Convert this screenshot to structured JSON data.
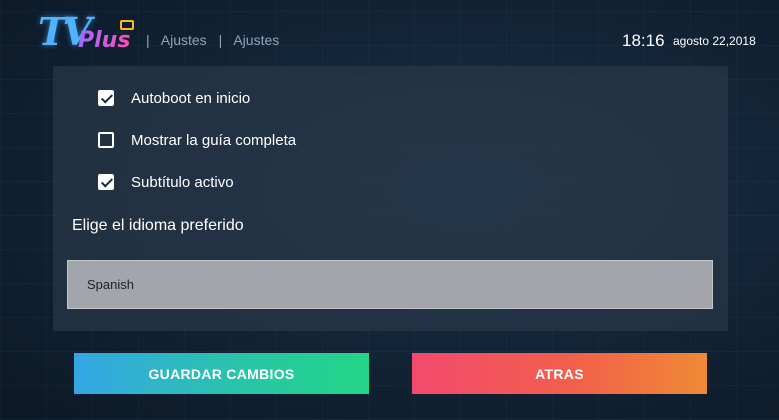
{
  "app": {
    "logo_tv": "TV",
    "logo_plus": "Plus"
  },
  "breadcrumb": {
    "sep1": "|",
    "item1": "Ajustes",
    "sep2": "|",
    "item2": "Ajustes"
  },
  "status": {
    "time": "18:16",
    "date": "agosto 22,2018"
  },
  "options": [
    {
      "label": "Autoboot en inicio",
      "checked": true
    },
    {
      "label": "Mostrar la guía completa",
      "checked": false
    },
    {
      "label": "Subtítulo activo",
      "checked": true
    }
  ],
  "language": {
    "title": "Elige el idioma preferido",
    "selected": "Spanish"
  },
  "buttons": {
    "save": "GUARDAR CAMBIOS",
    "back": "ATRAS"
  },
  "colors": {
    "save_gradient": [
      "#35a6e6",
      "#22d686"
    ],
    "back_gradient": [
      "#f24a6e",
      "#ee8a34"
    ]
  },
  "icons": [
    "checkbox-checked-icon",
    "checkbox-unchecked-icon",
    "tv-antenna-icon"
  ]
}
